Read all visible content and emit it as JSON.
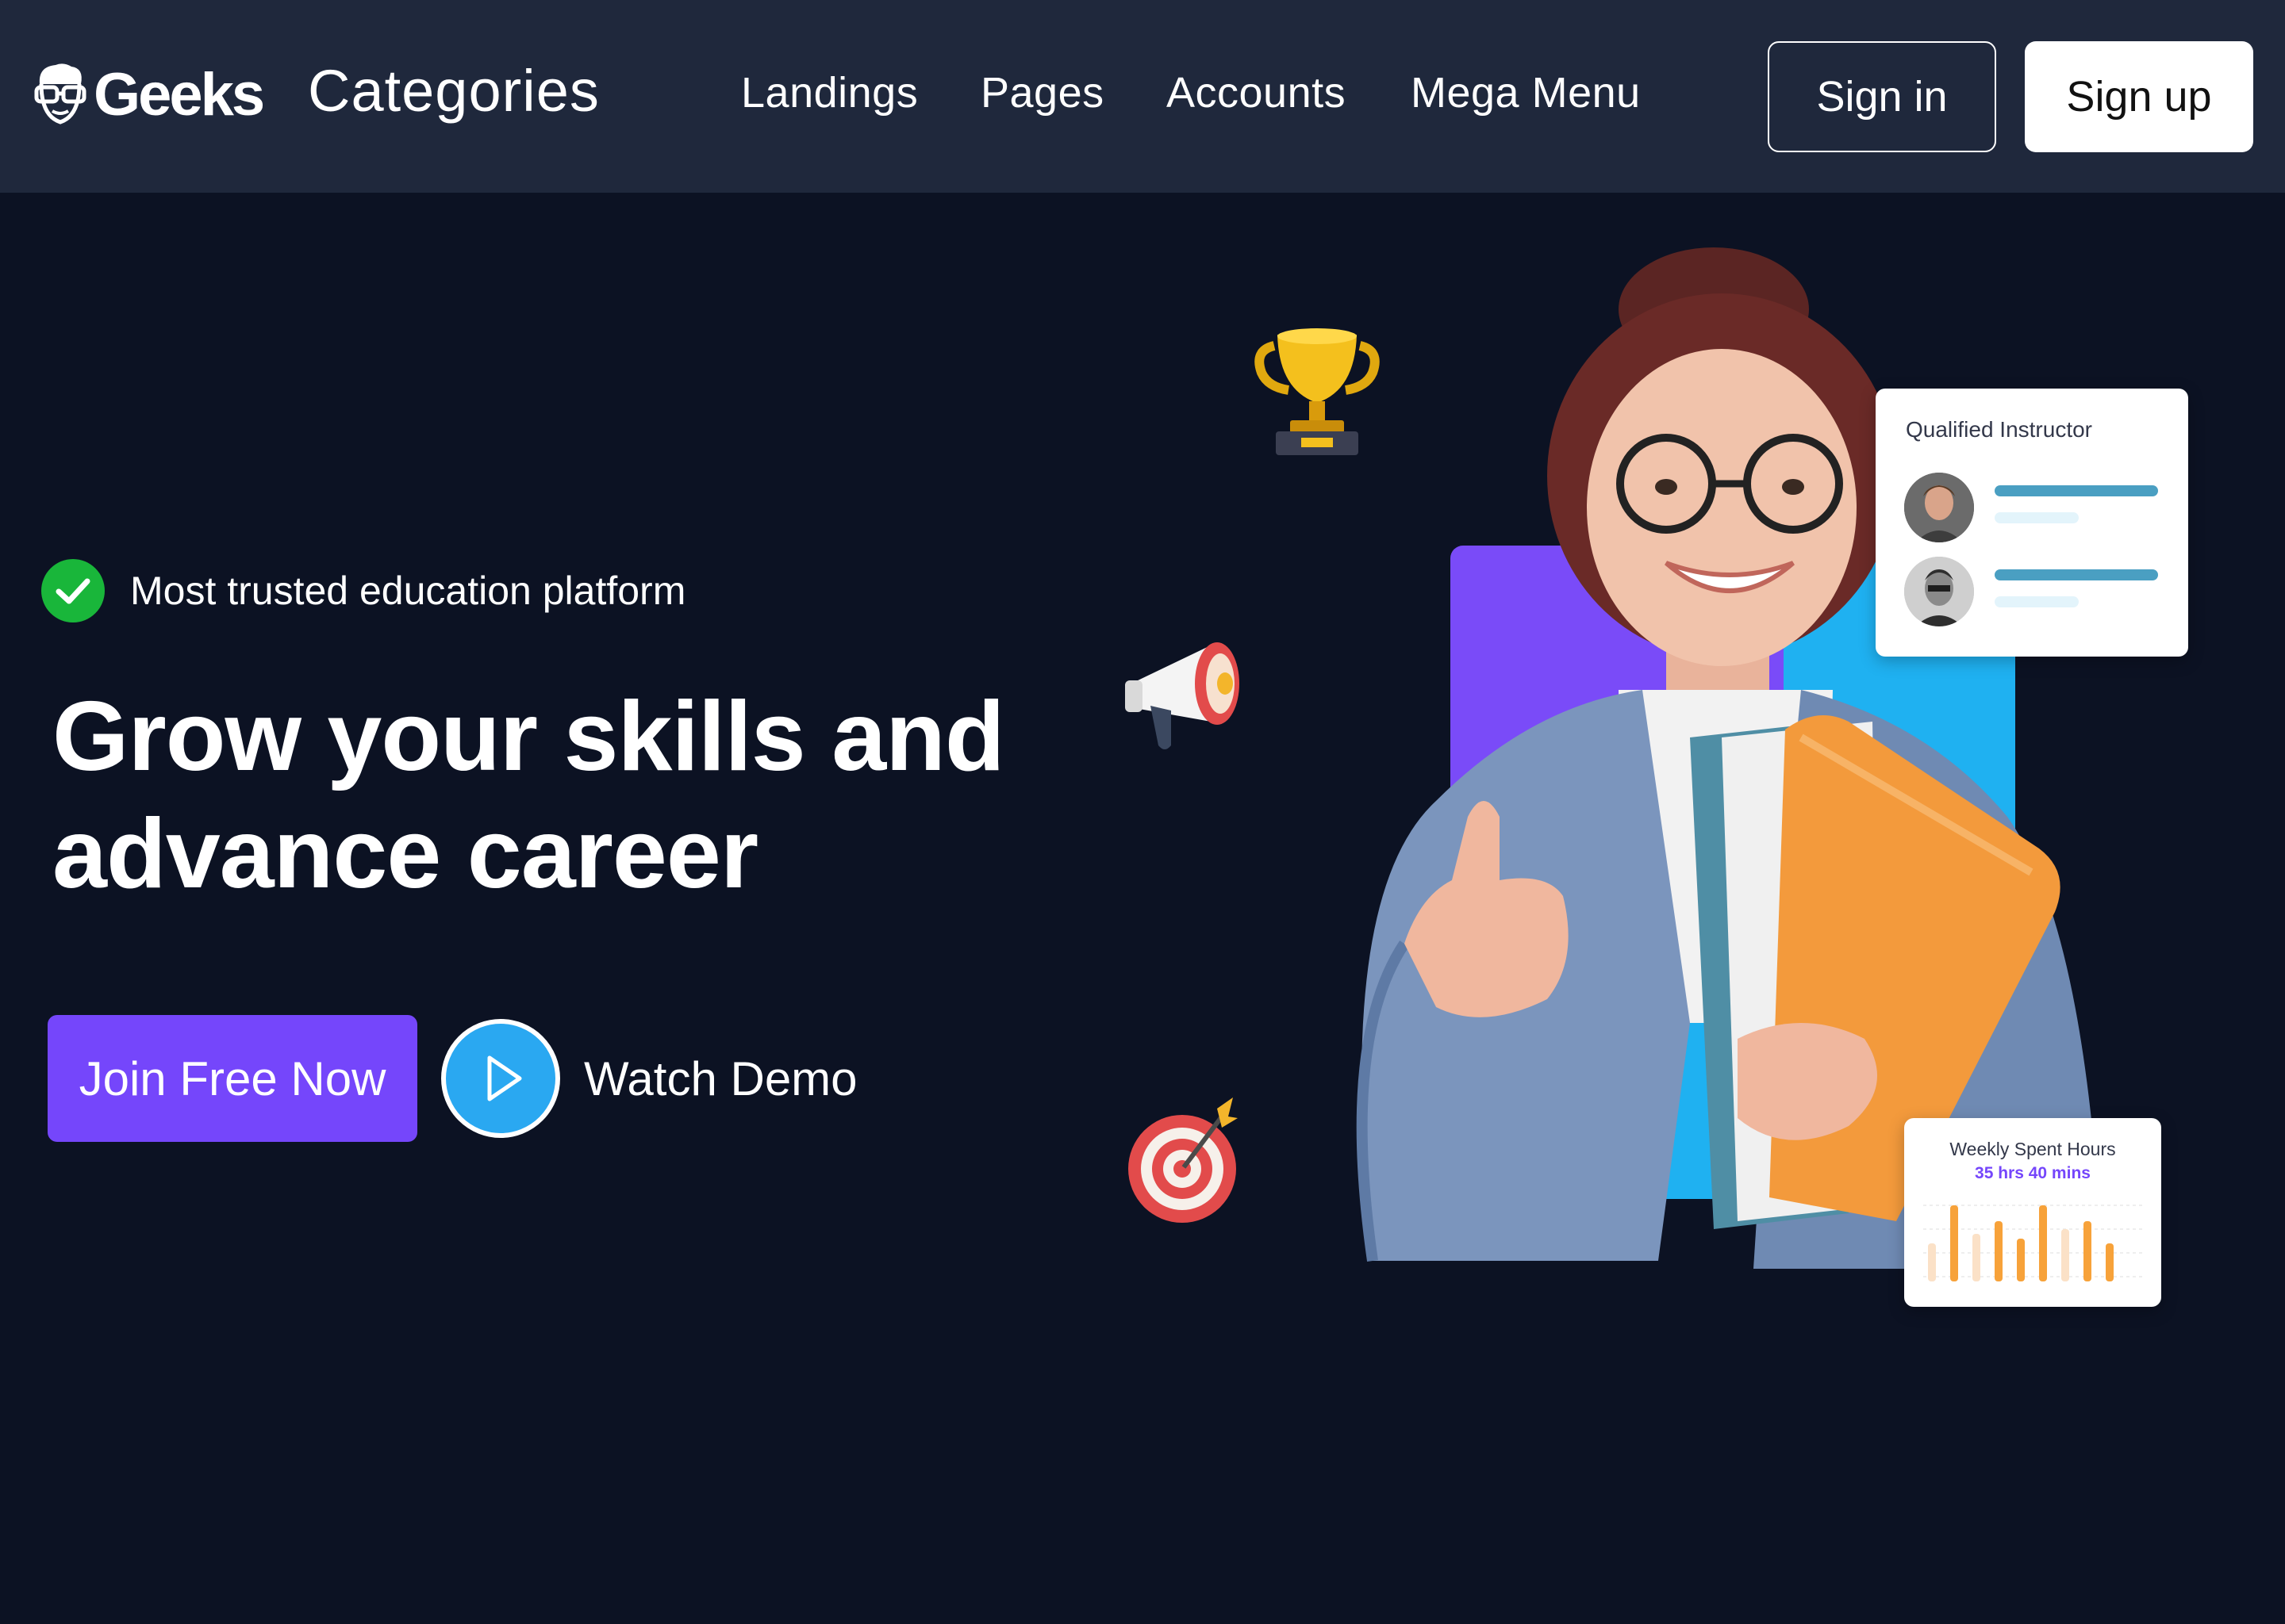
{
  "brand": {
    "name": "Geeks"
  },
  "nav": {
    "categories": "Categories",
    "links": [
      "Landings",
      "Pages",
      "Accounts",
      "Mega Menu"
    ],
    "sign_in": "Sign in",
    "sign_up": "Sign up"
  },
  "hero": {
    "trust_text": "Most trusted education platform",
    "headline_line1": "Grow your skills and",
    "headline_line2": "advance career",
    "join_label": "Join Free Now",
    "watch_label": "Watch Demo"
  },
  "cards": {
    "instructor_title": "Qualified Instructor",
    "hours_title": "Weekly Spent Hours",
    "hours_value": "35 hrs 40 mins"
  },
  "colors": {
    "page_bg": "#0c1223",
    "navbar_bg": "#1f283c",
    "accent_purple": "#7546fb",
    "accent_blue": "#2aa8f1",
    "check_green": "#19b63a",
    "bar_orange": "#f7a23a"
  },
  "icons": [
    "geek-logo-icon",
    "check-icon",
    "play-icon",
    "trophy-icon",
    "megaphone-icon",
    "target-icon"
  ]
}
